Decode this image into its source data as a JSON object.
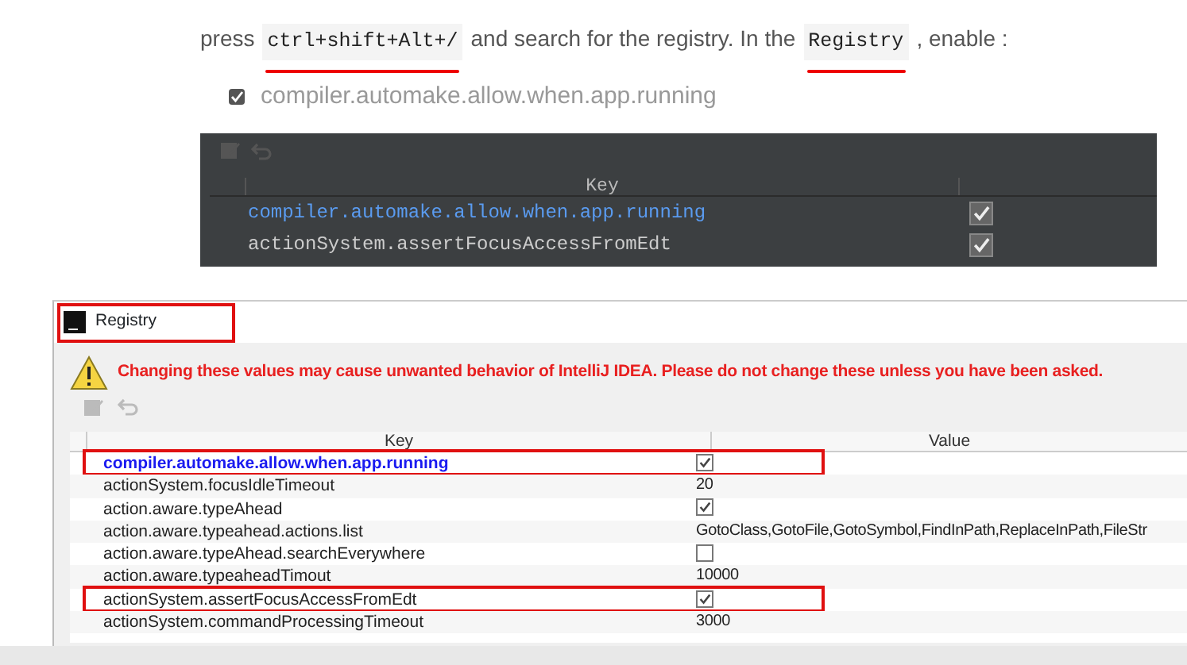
{
  "article": {
    "instruction": [
      {
        "kind": "text",
        "text": "press"
      },
      {
        "kind": "code",
        "text": "ctrl+shift+Alt+/",
        "underlined": true
      },
      {
        "kind": "text",
        "text": "and search for the registry. In the"
      },
      {
        "kind": "code",
        "text": "Registry",
        "underlined": true
      },
      {
        "kind": "text",
        "text": ", enable :"
      }
    ],
    "option": {
      "label": "compiler.automake.allow.when.app.running",
      "checked": true
    },
    "dark_table": {
      "columns": [
        "Key"
      ],
      "rows": [
        {
          "key": "compiler.automake.allow.when.app.running",
          "selected": true,
          "checked": true
        },
        {
          "key": "actionSystem.assertFocusAccessFromEdt",
          "selected": false,
          "checked": true
        }
      ]
    }
  },
  "registry": {
    "window": {
      "title": "Registry",
      "highlighted": true
    },
    "warning": "Changing these values may cause unwanted behavior of IntelliJ IDEA. Please do not change these unless you have been asked.",
    "columns": [
      "Key",
      "Value"
    ],
    "rows": [
      {
        "key": "compiler.automake.allow.when.app.running",
        "kind": "checkbox",
        "checked": true,
        "selected": true,
        "highlighted": true
      },
      {
        "key": "actionSystem.focusIdleTimeout",
        "kind": "text",
        "value": "20",
        "selected": false,
        "highlighted": false
      },
      {
        "key": "action.aware.typeAhead",
        "kind": "checkbox",
        "checked": true,
        "selected": false,
        "highlighted": false
      },
      {
        "key": "action.aware.typeahead.actions.list",
        "kind": "text",
        "value": "GotoClass,GotoFile,GotoSymbol,FindInPath,ReplaceInPath,FileStr",
        "selected": false,
        "highlighted": false
      },
      {
        "key": "action.aware.typeAhead.searchEverywhere",
        "kind": "checkbox",
        "checked": false,
        "selected": false,
        "highlighted": false
      },
      {
        "key": "action.aware.typeaheadTimout",
        "kind": "text",
        "value": "10000",
        "selected": false,
        "highlighted": false
      },
      {
        "key": "actionSystem.assertFocusAccessFromEdt",
        "kind": "checkbox",
        "checked": true,
        "selected": false,
        "highlighted": true
      },
      {
        "key": "actionSystem.commandProcessingTimeout",
        "kind": "text",
        "value": "3000",
        "selected": false,
        "highlighted": false
      }
    ]
  }
}
